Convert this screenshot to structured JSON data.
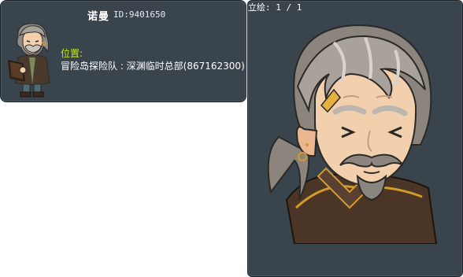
{
  "npc": {
    "name": "诺曼",
    "id_text": "ID:9401650",
    "location_label": "位置:",
    "location_value": "冒险岛探险队 : 深渊临时总部(867162300)"
  },
  "illustration": {
    "caption": "立绘: 1 / 1"
  },
  "icons": {
    "sprite": "old-man-reading-book-sprite",
    "portrait": "old-man-portrait"
  },
  "colors": {
    "panel_bg": "#3a444d",
    "location_label": "#c4e81c"
  }
}
